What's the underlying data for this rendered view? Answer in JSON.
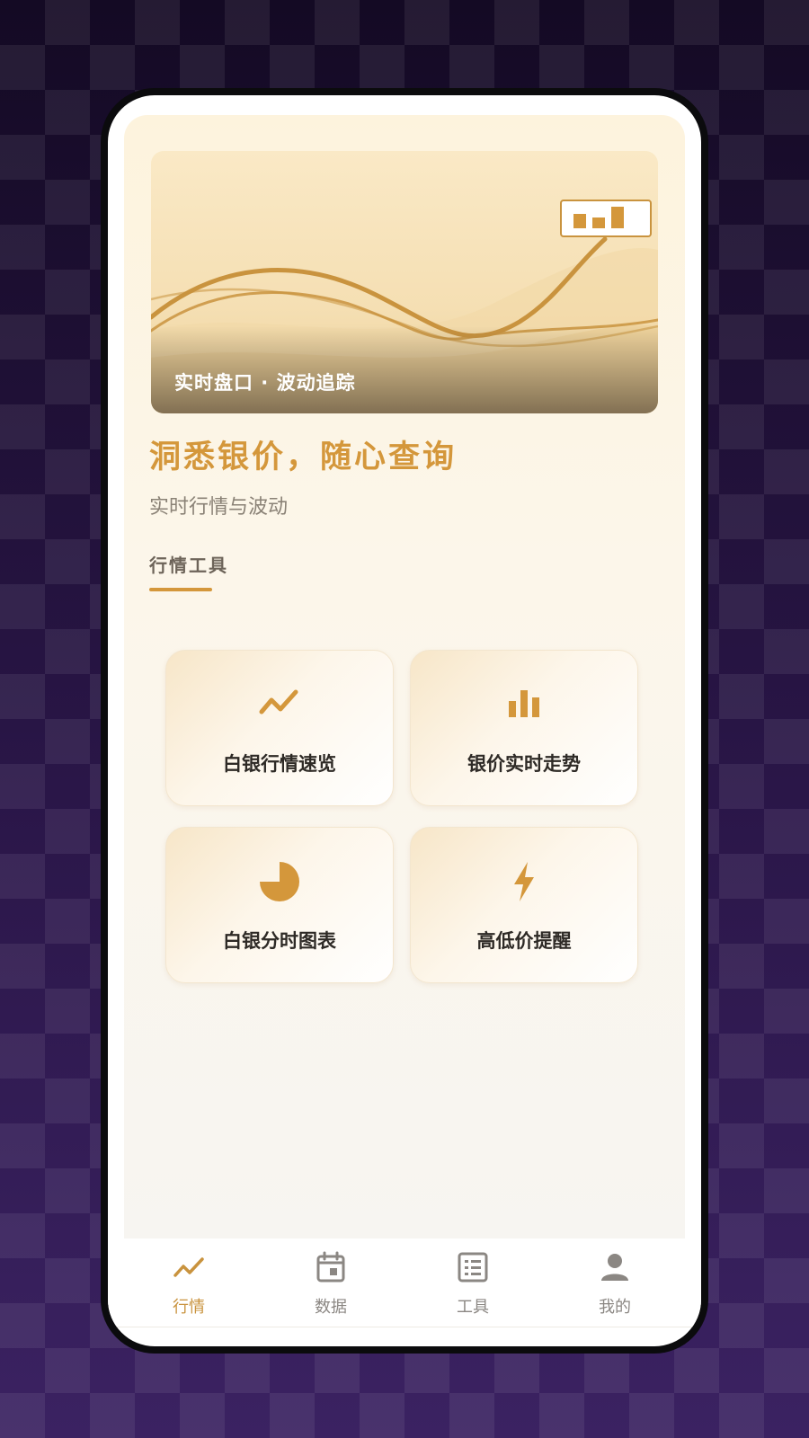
{
  "banner": {
    "caption": "实时盘口 · 波动追踪",
    "chart_icon": "bar-chart-icon"
  },
  "hero": {
    "headline": "洞悉银价，随心查询",
    "subline": "实时行情与波动"
  },
  "section": {
    "title": "行情工具"
  },
  "tools": [
    {
      "label": "白银行情速览",
      "icon": "trend-line-icon"
    },
    {
      "label": "银价实时走势",
      "icon": "bar-chart-icon"
    },
    {
      "label": "白银分时图表",
      "icon": "pie-chart-icon"
    },
    {
      "label": "高低价提醒",
      "icon": "lightning-icon"
    }
  ],
  "tabbar": {
    "active": 0,
    "tabs": [
      {
        "label": "行情",
        "icon": "trend-line-icon"
      },
      {
        "label": "数据",
        "icon": "calendar-icon"
      },
      {
        "label": "工具",
        "icon": "list-icon"
      },
      {
        "label": "我的",
        "icon": "person-icon"
      }
    ]
  },
  "colors": {
    "accent": "#d4973b",
    "banner_line": "#c9933e",
    "tab_inactive": "#8b8783",
    "card_text": "#2e2a26"
  }
}
